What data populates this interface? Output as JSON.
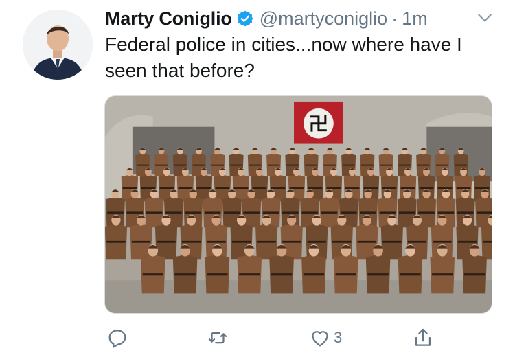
{
  "tweet": {
    "display_name": "Marty Coniglio",
    "verified": true,
    "handle": "@martyconiglio",
    "separator": "·",
    "timestamp": "1m",
    "text": "Federal police in cities...now where have I seen that before?",
    "media": {
      "kind": "photo"
    },
    "actions": {
      "reply_icon": "reply-icon",
      "retweet_icon": "retweet-icon",
      "like_icon": "heart-icon",
      "like_count": "3",
      "share_icon": "share-icon"
    }
  },
  "colors": {
    "text": "#14171a",
    "secondary": "#657786",
    "verified_blue": "#1da1f2",
    "banner_red": "#b8202a"
  }
}
